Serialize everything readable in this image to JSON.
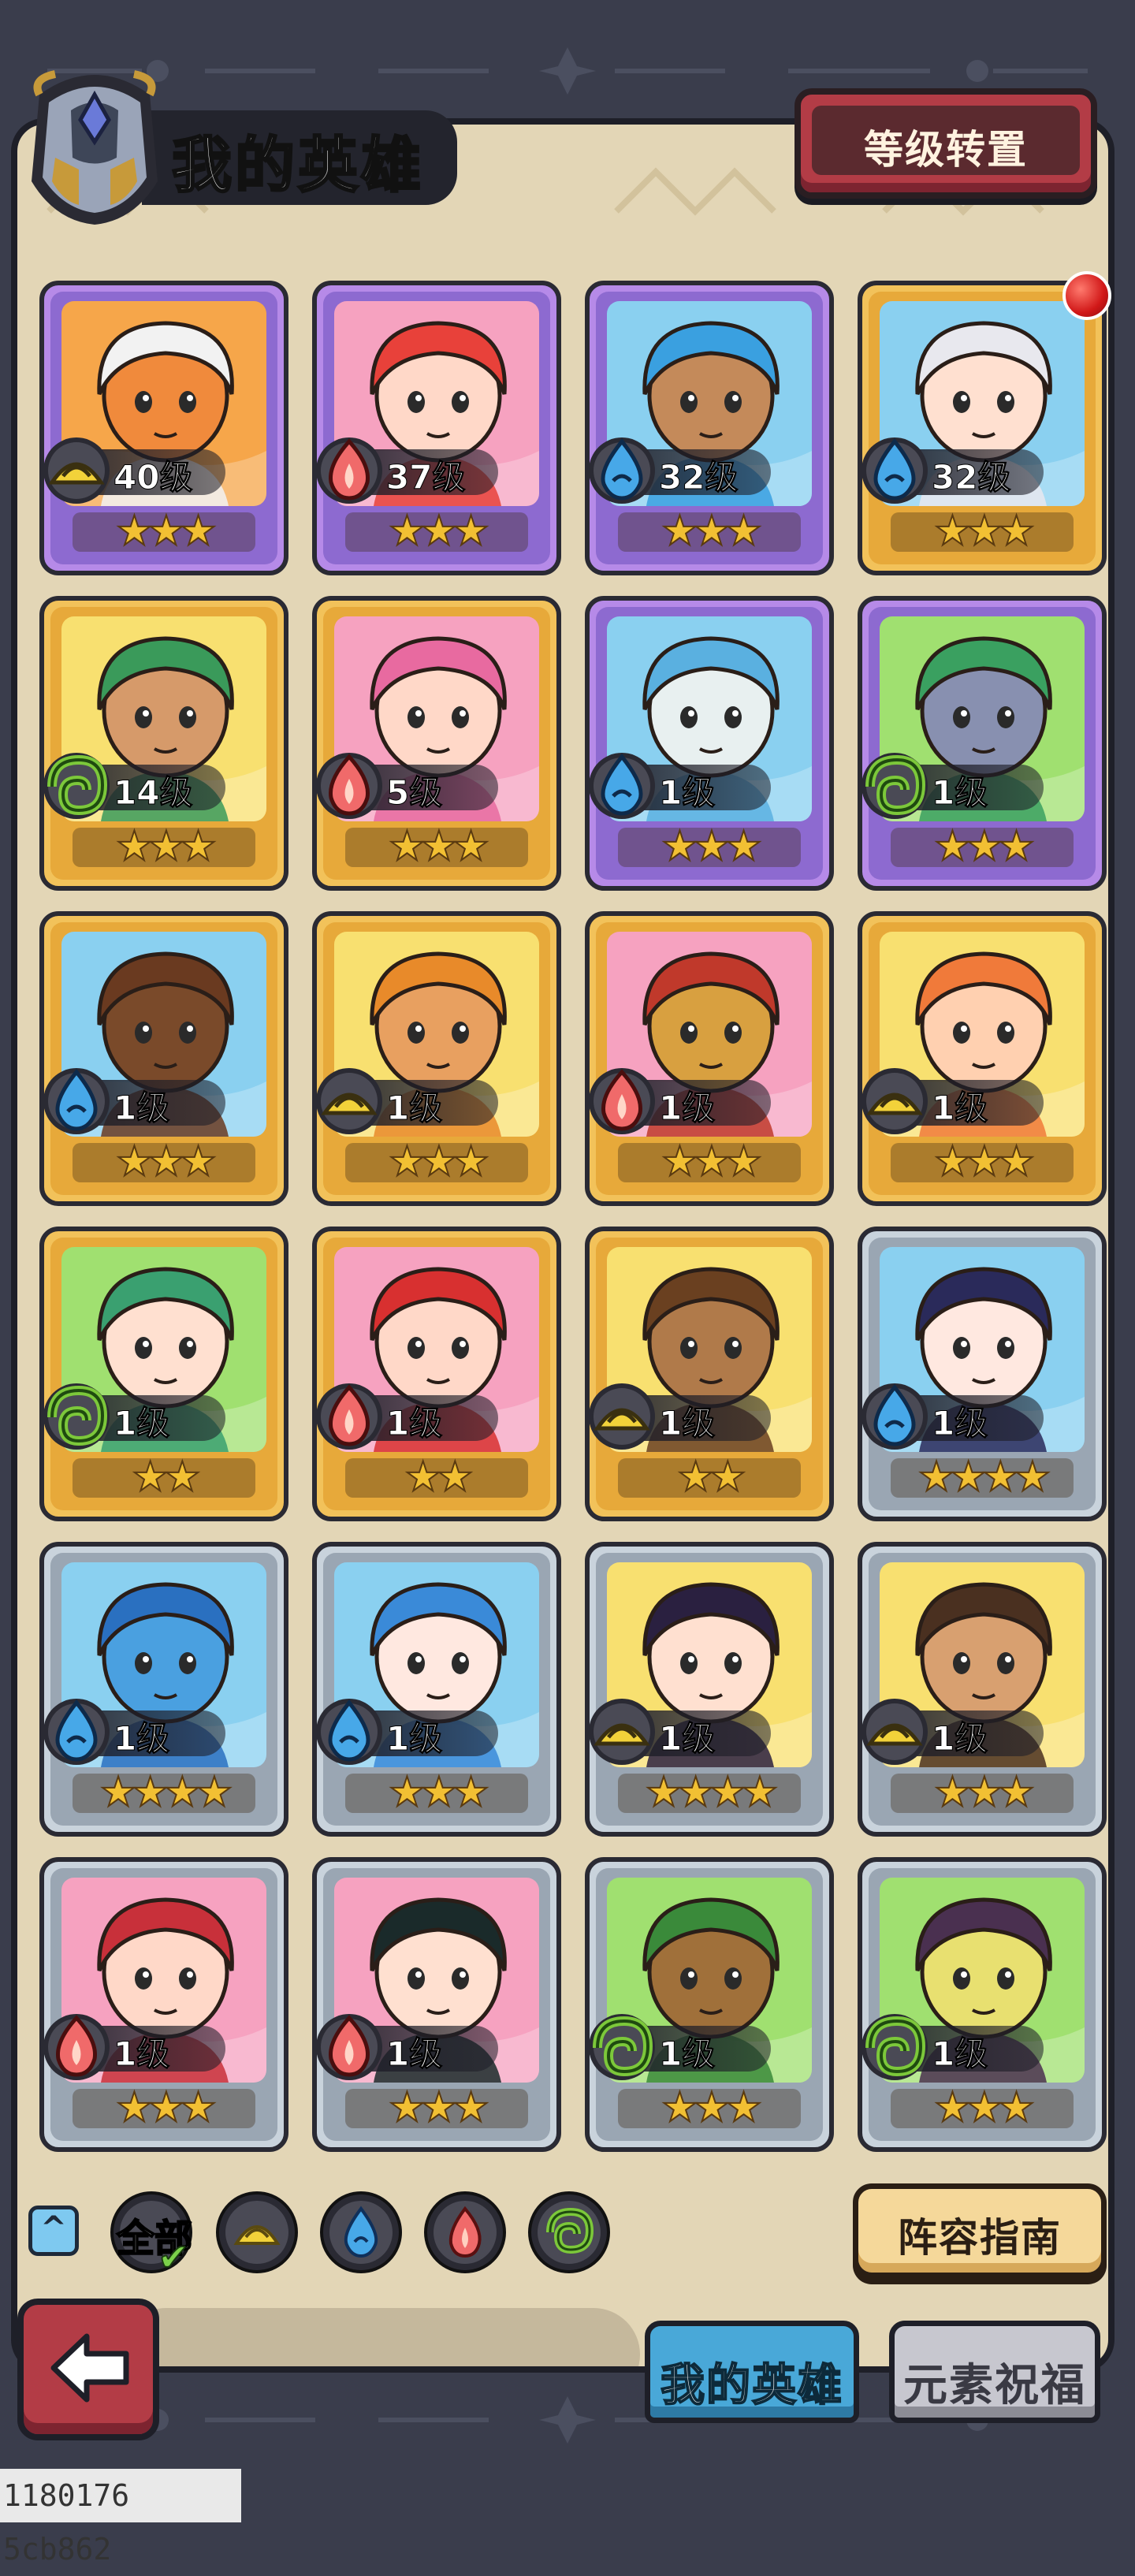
{
  "header": {
    "title": "我的英雄",
    "level_transfer_label": "等级转置",
    "notification": true
  },
  "heroes": [
    {
      "level": "40级",
      "element": "earth",
      "stars": "★★★",
      "frame": "purple",
      "bg": "#f6a64a",
      "skin": "#f08a3c",
      "hair": "#f2f2f2"
    },
    {
      "level": "37级",
      "element": "fire",
      "stars": "★★★",
      "frame": "purple",
      "bg": "#f6a2c0",
      "skin": "#ffd8c8",
      "hair": "#e8413a"
    },
    {
      "level": "32级",
      "element": "water",
      "stars": "★★★",
      "frame": "purple",
      "bg": "#8ad0f0",
      "skin": "#c48a5a",
      "hair": "#3aa0e0"
    },
    {
      "level": "32级",
      "element": "water",
      "stars": "★★★",
      "frame": "gold",
      "bg": "#8ad0f0",
      "skin": "#ffe0d0",
      "hair": "#e8e8ee"
    },
    {
      "level": "14级",
      "element": "wind",
      "stars": "★★★",
      "frame": "gold",
      "bg": "#f8e070",
      "skin": "#d69a6a",
      "hair": "#3a9a5a"
    },
    {
      "level": "5级",
      "element": "fire",
      "stars": "★★★",
      "frame": "gold",
      "bg": "#f6a2c0",
      "skin": "#ffd8c8",
      "hair": "#e86aa0"
    },
    {
      "level": "1级",
      "element": "water",
      "stars": "★★★",
      "frame": "purple",
      "bg": "#8ad0f0",
      "skin": "#e8f0f0",
      "hair": "#5ab0e0"
    },
    {
      "level": "1级",
      "element": "wind",
      "stars": "★★★",
      "frame": "purple",
      "bg": "#a0e070",
      "skin": "#8890b0",
      "hair": "#3aa060"
    },
    {
      "level": "1级",
      "element": "water",
      "stars": "★★★",
      "frame": "gold",
      "bg": "#8ad0f0",
      "skin": "#7a4a2a",
      "hair": "#6a3a20"
    },
    {
      "level": "1级",
      "element": "earth",
      "stars": "★★★",
      "frame": "gold",
      "bg": "#f8e070",
      "skin": "#e8a060",
      "hair": "#e88a2a"
    },
    {
      "level": "1级",
      "element": "fire",
      "stars": "★★★",
      "frame": "gold",
      "bg": "#f6a2c0",
      "skin": "#d8a040",
      "hair": "#c0392b"
    },
    {
      "level": "1级",
      "element": "earth",
      "stars": "★★★",
      "frame": "gold",
      "bg": "#f8e070",
      "skin": "#ffd0b0",
      "hair": "#f07a3a"
    },
    {
      "level": "1级",
      "element": "wind",
      "stars": "★★",
      "frame": "gold",
      "bg": "#a0e070",
      "skin": "#ffe0d0",
      "hair": "#3aa070"
    },
    {
      "level": "1级",
      "element": "fire",
      "stars": "★★",
      "frame": "gold",
      "bg": "#f6a2c0",
      "skin": "#ffd8c8",
      "hair": "#d83030"
    },
    {
      "level": "1级",
      "element": "earth",
      "stars": "★★",
      "frame": "gold",
      "bg": "#f8e070",
      "skin": "#b07a4a",
      "hair": "#6a4020"
    },
    {
      "level": "1级",
      "element": "water",
      "stars": "★★★★",
      "frame": "silver",
      "bg": "#8ad0f0",
      "skin": "#ffe8e0",
      "hair": "#2a2a5a"
    },
    {
      "level": "1级",
      "element": "water",
      "stars": "★★★★",
      "frame": "silver",
      "bg": "#8ad0f0",
      "skin": "#4aa0e0",
      "hair": "#2a70c0"
    },
    {
      "level": "1级",
      "element": "water",
      "stars": "★★★",
      "frame": "silver",
      "bg": "#8ad0f0",
      "skin": "#ffe8e0",
      "hair": "#3a8ad8"
    },
    {
      "level": "1级",
      "element": "earth",
      "stars": "★★★★",
      "frame": "silver",
      "bg": "#f8e070",
      "skin": "#ffe0d0",
      "hair": "#2a2040"
    },
    {
      "level": "1级",
      "element": "earth",
      "stars": "★★★",
      "frame": "silver",
      "bg": "#f8e070",
      "skin": "#d8a070",
      "hair": "#4a3020"
    },
    {
      "level": "1级",
      "element": "fire",
      "stars": "★★★",
      "frame": "silver",
      "bg": "#f6a2c0",
      "skin": "#ffd8c8",
      "hair": "#c8303a"
    },
    {
      "level": "1级",
      "element": "fire",
      "stars": "★★★",
      "frame": "silver",
      "bg": "#f6a2c0",
      "skin": "#ffe0d0",
      "hair": "#1a2a2a"
    },
    {
      "level": "1级",
      "element": "wind",
      "stars": "★★★",
      "frame": "silver",
      "bg": "#a0e070",
      "skin": "#a0703a",
      "hair": "#3a8a3a"
    },
    {
      "level": "1级",
      "element": "wind",
      "stars": "★★★",
      "frame": "silver",
      "bg": "#a0e070",
      "skin": "#e8e070",
      "hair": "#4a3050"
    }
  ],
  "filters": {
    "all_label": "全部",
    "elements": [
      "earth",
      "water",
      "fire",
      "wind"
    ]
  },
  "lineup_guide_label": "阵容指南",
  "tabs": {
    "my_heroes": "我的英雄",
    "element_blessing": "元素祝福"
  },
  "debug_overlay": "1180176 5cb862",
  "colors": {
    "earth": "#f2d23a",
    "water": "#47a8e8",
    "fire": "#f06a6a",
    "wind": "#7cc83a",
    "frame_gold": "#f2c25a",
    "frame_purple": "#b68ae8",
    "frame_silver": "#c9d3dc"
  }
}
